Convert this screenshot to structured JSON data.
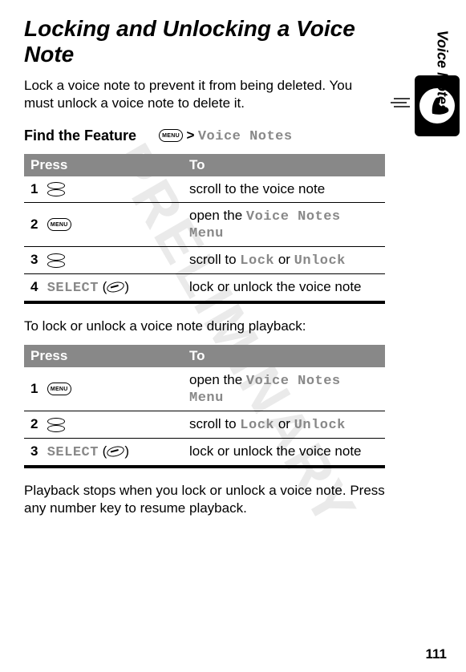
{
  "watermark": "PRELIMINARY",
  "title": "Locking and Unlocking a Voice Note",
  "intro": "Lock a voice note to prevent it from being deleted. You must unlock a voice note to delete it.",
  "find_feature_label": "Find the Feature",
  "gt": ">",
  "voice_notes_text": "Voice Notes",
  "table_headers": {
    "press": "Press",
    "to": "To"
  },
  "table1": {
    "rows": [
      {
        "num": "1",
        "to_pre": "scroll to the voice note",
        "menu_text": ""
      },
      {
        "num": "2",
        "to_pre": "open the ",
        "menu_text": "Voice Notes Menu"
      },
      {
        "num": "3",
        "to_pre": "scroll to ",
        "menu_text": "Lock",
        "mid": " or ",
        "menu_text2": "Unlock"
      },
      {
        "num": "4",
        "select_label": "SELECT",
        "to_pre": "lock or unlock the voice note"
      }
    ]
  },
  "midtext": "To lock or unlock a voice note during playback:",
  "table2": {
    "rows": [
      {
        "num": "1",
        "to_pre": "open the ",
        "menu_text": "Voice Notes Menu"
      },
      {
        "num": "2",
        "to_pre": "scroll to ",
        "menu_text": "Lock",
        "mid": " or ",
        "menu_text2": "Unlock"
      },
      {
        "num": "3",
        "select_label": "SELECT",
        "to_pre": "lock or unlock the voice note"
      }
    ]
  },
  "outro": "Playback stops when you lock or unlock a voice note. Press any number key to resume playback.",
  "side_label": "Voice Notes",
  "page_number": "111",
  "menu_icon_text": "MENU"
}
